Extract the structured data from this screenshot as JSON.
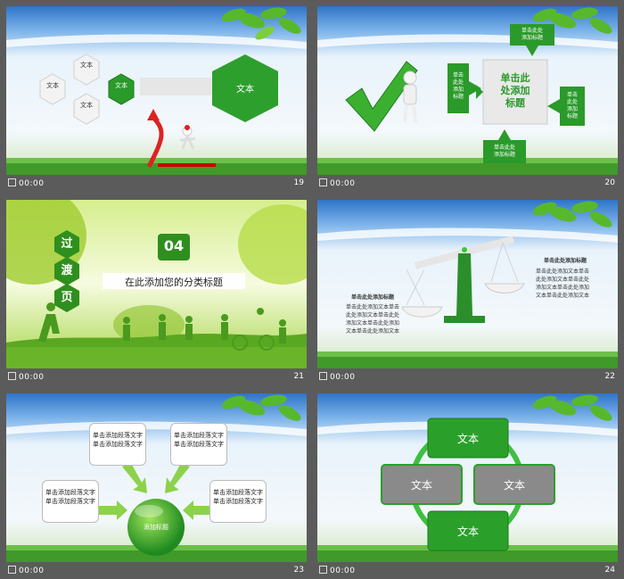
{
  "slides": [
    {
      "num": "19",
      "time": "00:00",
      "texts": {
        "hex_top": "文本",
        "hex_left": "文本",
        "hex_bottom": "文本",
        "hex_green": "文本",
        "hex_big": "文本"
      }
    },
    {
      "num": "20",
      "time": "00:00",
      "texts": {
        "center": "单击此\n处添加\n标题",
        "top": "单击此处\n添加标题",
        "left": "单击\n此处\n添加\n标题",
        "right": "单击\n此处\n添加\n标题",
        "bottom": "单击此处\n添加标题"
      }
    },
    {
      "num": "21",
      "time": "00:00",
      "texts": {
        "v1": "过",
        "v2": "渡",
        "v3": "页",
        "number": "04",
        "subtitle": "在此添加您的分类标题"
      }
    },
    {
      "num": "22",
      "time": "00:00",
      "texts": {
        "left_title": "单击此处添加标题",
        "left_body": "单击此处添加文本单击\n此处添加文本单击此处\n添加文本单击此处添加\n文本单击此处添加文本",
        "right_title": "单击此处添加标题",
        "right_body": "单击此处添加文本单击\n此处添加文本单击此处\n添加文本单击此处添加\n文本单击此处添加文本"
      }
    },
    {
      "num": "23",
      "time": "00:00",
      "texts": {
        "box_tl": "单击添加段落文字\n单击添加段落文字",
        "box_tr": "单击添加段落文字\n单击添加段落文字",
        "box_ml": "单击添加段落文字\n单击添加段落文字",
        "box_mr": "单击添加段落文字\n单击添加段落文字",
        "center": "添加标题"
      }
    },
    {
      "num": "24",
      "time": "00:00",
      "texts": {
        "top": "文本",
        "left": "文本",
        "right": "文本",
        "bottom": "文本"
      }
    }
  ],
  "colors": {
    "green": "#2f9e2f",
    "dark_green": "#1a7a1a",
    "sky": "#3a86d6",
    "grass": "#5ab83a",
    "panel_bg": "#5b5b5b"
  }
}
